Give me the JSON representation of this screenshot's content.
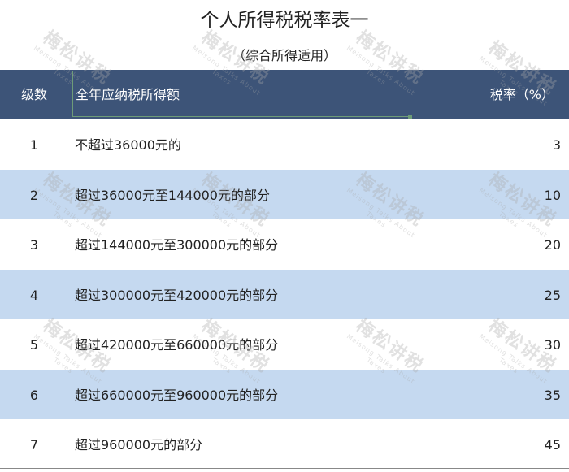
{
  "title": "个人所得税税率表一",
  "subtitle": "（综合所得适用）",
  "header": {
    "level": "级数",
    "range": "全年应纳税所得额",
    "rate": "税率（%）"
  },
  "rows": [
    {
      "level": "1",
      "range": "不超过36000元的",
      "rate": "3"
    },
    {
      "level": "2",
      "range": "超过36000元至144000元的部分",
      "rate": "10"
    },
    {
      "level": "3",
      "range": "超过144000元至300000元的部分",
      "rate": "20"
    },
    {
      "level": "4",
      "range": "超过300000元至420000元的部分",
      "rate": "25"
    },
    {
      "level": "5",
      "range": "超过420000元至660000元的部分",
      "rate": "30"
    },
    {
      "level": "6",
      "range": "超过660000元至960000元的部分",
      "rate": "35"
    },
    {
      "level": "7",
      "range": "超过960000元的部分",
      "rate": "45"
    }
  ],
  "watermark": {
    "text": "梅松讲税",
    "sub": "Meisong Talks About Taxes"
  },
  "colors": {
    "header_bg": "#3d5478",
    "alt_row_bg": "#c5d9f0",
    "selection_border": "#6e9c78"
  }
}
